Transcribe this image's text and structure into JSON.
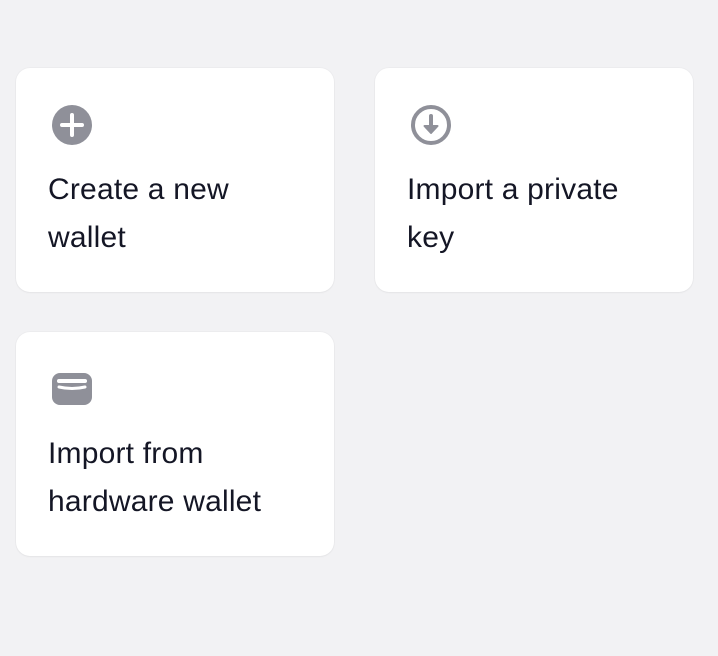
{
  "options": [
    {
      "id": "create",
      "label": "Create a new wallet",
      "icon": "plus-circle-icon"
    },
    {
      "id": "import-key",
      "label": "Import a private key",
      "icon": "download-circle-icon"
    },
    {
      "id": "import-hardware",
      "label": "Import from hardware wallet",
      "icon": "hardware-wallet-icon"
    }
  ],
  "colors": {
    "background": "#f2f2f4",
    "card": "#ffffff",
    "icon": "#8f9099",
    "text": "#141625"
  }
}
